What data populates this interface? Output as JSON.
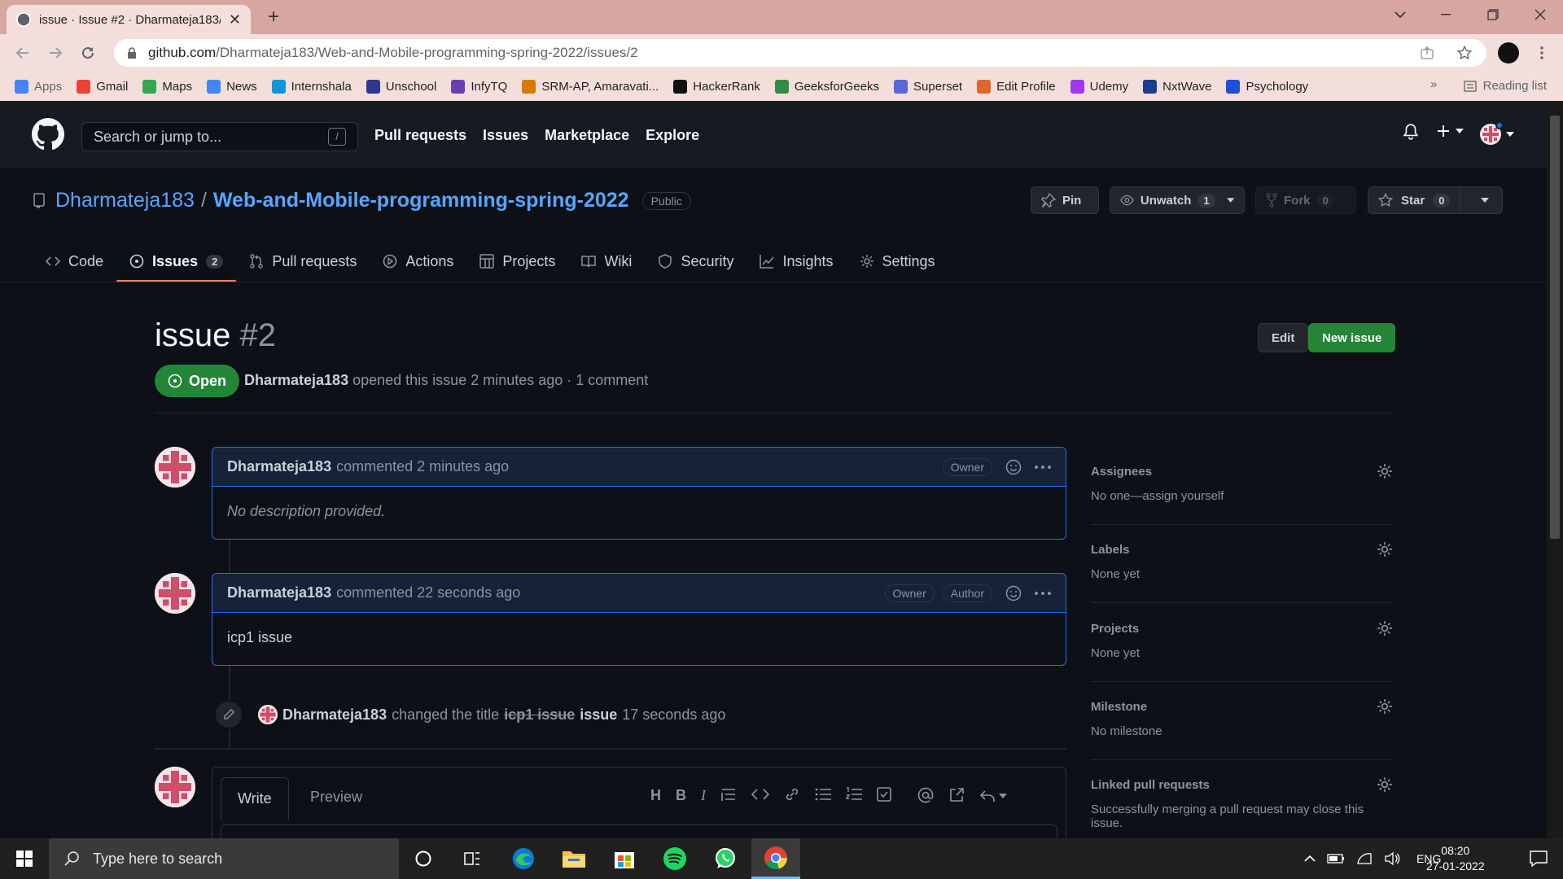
{
  "browser": {
    "tab_title": "issue · Issue #2 · Dharmateja183/",
    "url_host": "github.com",
    "url_path": "/Dharmateja183/Web-and-Mobile-programming-spring-2022/issues/2",
    "bookmarks": [
      {
        "label": "Apps",
        "color": "#4285f4"
      },
      {
        "label": "Gmail",
        "color": "#ea4335"
      },
      {
        "label": "Maps",
        "color": "#34a853"
      },
      {
        "label": "News",
        "color": "#4285f4"
      },
      {
        "label": "Internshala",
        "color": "#1295d8"
      },
      {
        "label": "Unschool",
        "color": "#2b3a8f"
      },
      {
        "label": "InfyTQ",
        "color": "#6a3fb5"
      },
      {
        "label": "SRM-AP, Amaravati...",
        "color": "#d97a00"
      },
      {
        "label": "HackerRank",
        "color": "#111111"
      },
      {
        "label": "GeeksforGeeks",
        "color": "#2f8d46"
      },
      {
        "label": "Superset",
        "color": "#5a67d8"
      },
      {
        "label": "Edit Profile",
        "color": "#e0662b"
      },
      {
        "label": "Udemy",
        "color": "#a435f0"
      },
      {
        "label": "NxtWave",
        "color": "#1a3d8f"
      },
      {
        "label": "Psychology",
        "color": "#1e4fd6"
      }
    ],
    "reading_list": "Reading list"
  },
  "github": {
    "search_placeholder": "Search or jump to...",
    "search_key": "/",
    "nav": [
      "Pull requests",
      "Issues",
      "Marketplace",
      "Explore"
    ]
  },
  "repo": {
    "owner": "Dharmateja183",
    "separator": "/",
    "name": "Web-and-Mobile-programming-spring-2022",
    "visibility": "Public",
    "pin_label": "Pin",
    "unwatch_label": "Unwatch",
    "unwatch_count": "1",
    "fork_label": "Fork",
    "fork_count": "0",
    "star_label": "Star",
    "star_count": "0",
    "tabs": [
      {
        "label": "Code",
        "icon": "code-icon"
      },
      {
        "label": "Issues",
        "icon": "issue-icon",
        "count": "2",
        "selected": true
      },
      {
        "label": "Pull requests",
        "icon": "pull-request-icon"
      },
      {
        "label": "Actions",
        "icon": "play-icon"
      },
      {
        "label": "Projects",
        "icon": "table-icon"
      },
      {
        "label": "Wiki",
        "icon": "book-icon"
      },
      {
        "label": "Security",
        "icon": "shield-icon"
      },
      {
        "label": "Insights",
        "icon": "graph-icon"
      },
      {
        "label": "Settings",
        "icon": "gear-icon"
      }
    ]
  },
  "issue": {
    "title": "issue",
    "number": "#2",
    "state": "Open",
    "author": "Dharmateja183",
    "meta_text": "opened this issue 2 minutes ago · 1 comment",
    "edit_label": "Edit",
    "new_issue_label": "New issue"
  },
  "comments": [
    {
      "author": "Dharmateja183",
      "action": "commented 2 minutes ago",
      "labels": [
        "Owner"
      ],
      "body": "No description provided.",
      "italic": true
    },
    {
      "author": "Dharmateja183",
      "action": "commented 22 seconds ago",
      "labels": [
        "Owner",
        "Author"
      ],
      "body": "icp1 issue",
      "italic": false
    }
  ],
  "event": {
    "author": "Dharmateja183",
    "text": "changed the title",
    "old_title": "icp1 issue",
    "new_title": "issue",
    "time": "17 seconds ago"
  },
  "composer": {
    "write_tab": "Write",
    "preview_tab": "Preview"
  },
  "sidebar": [
    {
      "heading": "Assignees",
      "value": "No one—assign yourself"
    },
    {
      "heading": "Labels",
      "value": "None yet"
    },
    {
      "heading": "Projects",
      "value": "None yet"
    },
    {
      "heading": "Milestone",
      "value": "No milestone"
    },
    {
      "heading": "Linked pull requests",
      "value": "Successfully merging a pull request may close this issue."
    }
  ],
  "taskbar": {
    "search_placeholder": "Type here to search",
    "language": "ENG",
    "time": "08:20",
    "date": "27-01-2022"
  },
  "colors": {
    "accent_green": "#238636",
    "link_blue": "#58a6ff",
    "tab_underline": "#f78166"
  }
}
